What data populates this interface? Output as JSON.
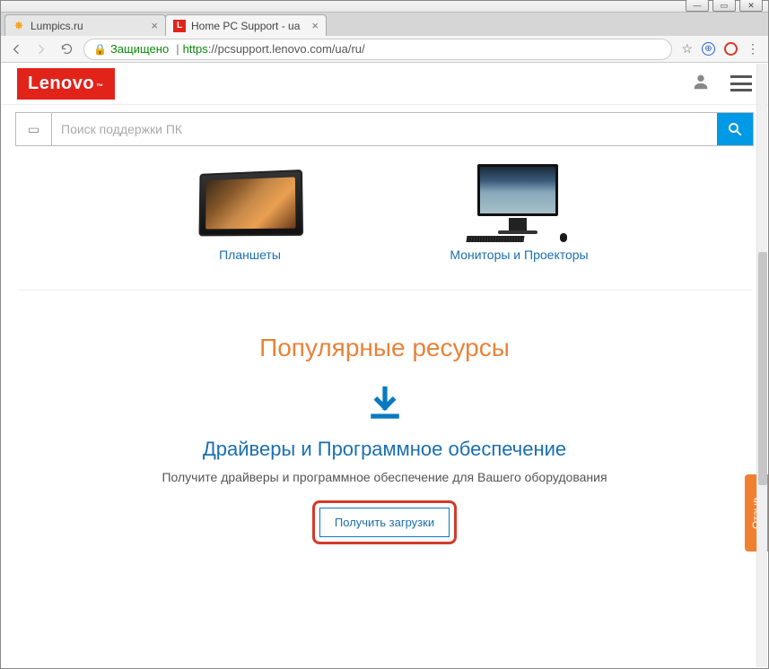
{
  "tabs": [
    {
      "title": "Lumpics.ru",
      "active": false,
      "favicon": "orange"
    },
    {
      "title": "Home PC Support - ua",
      "active": true,
      "favicon": "lenovo",
      "favicon_letter": "L"
    }
  ],
  "address_bar": {
    "secure_label": "Защищено",
    "protocol": "https",
    "url_rest": "://pcsupport.lenovo.com/ua/ru/"
  },
  "header": {
    "logo_text": "Lenovo",
    "logo_tm": "™"
  },
  "search": {
    "placeholder": "Поиск поддержки ПК"
  },
  "products": [
    {
      "label": "Планшеты",
      "kind": "tablet"
    },
    {
      "label": "Мониторы и Проекторы",
      "kind": "monitor"
    }
  ],
  "popular": {
    "heading": "Популярные ресурсы",
    "section_title": "Драйверы и Программное обеспечение",
    "section_desc": "Получите драйверы и программное обеспечение для Вашего оборудования",
    "button_label": "Получить загрузки"
  },
  "feedback_label": "Отзыв",
  "colors": {
    "brand_red": "#e2231a",
    "link_blue": "#1a6fb0",
    "accent_orange": "#e8833a",
    "search_blue": "#0099e6"
  }
}
